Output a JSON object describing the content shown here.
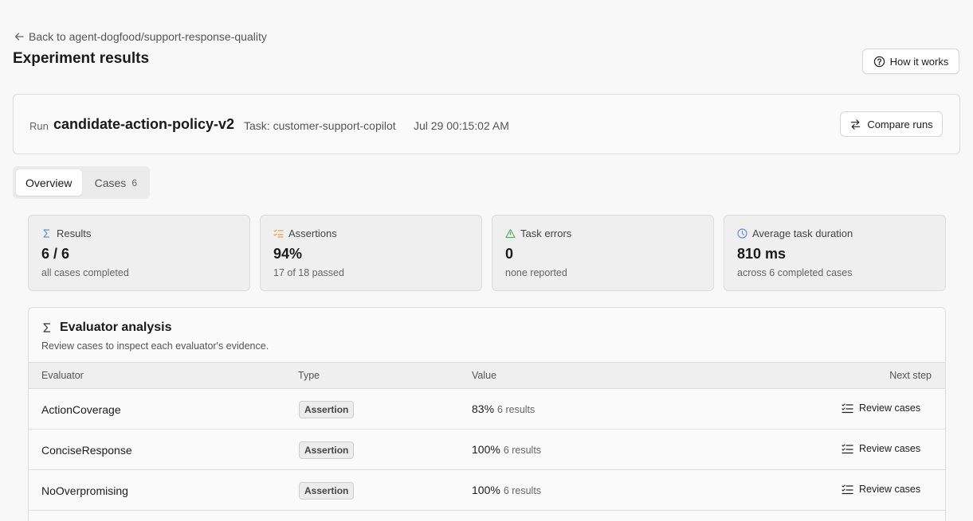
{
  "back_link": {
    "label": "Back to agent-dogfood/support-response-quality",
    "icon": "arrow-left-icon"
  },
  "page_title": "Experiment results",
  "how_it_works": {
    "label": "How it works",
    "icon": "help-circle-icon"
  },
  "run": {
    "label": "Run",
    "name": "candidate-action-policy-v2",
    "task": "Task: customer-support-copilot",
    "timestamp": "Jul 29 00:15:02 AM",
    "compare_label": "Compare runs"
  },
  "tabs": [
    {
      "label": "Overview",
      "active": true
    },
    {
      "label": "Cases",
      "count": "6",
      "active": false
    }
  ],
  "stats": [
    {
      "title": "Results",
      "icon": "sigma-icon",
      "value": "6 / 6",
      "sub": "all cases completed",
      "color": "#6b8fd6"
    },
    {
      "title": "Assertions",
      "icon": "checklist-icon",
      "value": "94%",
      "sub": "17 of 18 passed",
      "color": "#e0a24a"
    },
    {
      "title": "Task errors",
      "icon": "warning-triangle-icon",
      "value": "0",
      "sub": "none reported",
      "color": "#5aae6a"
    },
    {
      "title": "Average task duration",
      "icon": "clock-icon",
      "value": "810 ms",
      "sub": "across 6 completed cases",
      "color": "#6b8fd6"
    }
  ],
  "evaluator": {
    "title": "Evaluator analysis",
    "subtitle": "Review cases to inspect each evaluator's evidence.",
    "columns": [
      "Evaluator",
      "Type",
      "Value",
      "Next step"
    ],
    "rows": [
      {
        "name": "ActionCoverage",
        "type": "Assertion",
        "value": "83%",
        "results": "6 results",
        "action": "Review cases"
      },
      {
        "name": "ConciseResponse",
        "type": "Assertion",
        "value": "100%",
        "results": "6 results",
        "action": "Review cases"
      },
      {
        "name": "NoOverpromising",
        "type": "Assertion",
        "value": "100%",
        "results": "6 results",
        "action": "Review cases"
      }
    ]
  }
}
